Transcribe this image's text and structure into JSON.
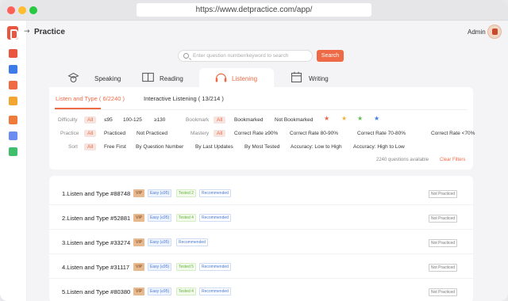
{
  "browser": {
    "url": "https://www.detpractice.com/app/"
  },
  "header": {
    "title": "Practice",
    "user": "Admin"
  },
  "search": {
    "placeholder": "Enter question number/keyword to search",
    "button": "Search"
  },
  "tabs": [
    {
      "label": "Speaking",
      "icon": "speaker-head-icon"
    },
    {
      "label": "Reading",
      "icon": "book-icon"
    },
    {
      "label": "Listening",
      "icon": "headphones-icon"
    },
    {
      "label": "Writing",
      "icon": "calendar-icon"
    }
  ],
  "subtabs": [
    {
      "label": "Listen and Type ( 6/2240 )"
    },
    {
      "label": "Interactive Listening ( 13/214 )"
    }
  ],
  "filters": {
    "difficulty": {
      "label": "Difficulty",
      "options": [
        "All",
        "≤95",
        "100-125",
        "≥130"
      ]
    },
    "bookmark": {
      "label": "Bookmark",
      "options": [
        "All",
        "Bookmarked",
        "Not Bookmarked"
      ]
    },
    "practice": {
      "label": "Practice",
      "options": [
        "All",
        "Practiced",
        "Not Practiced"
      ]
    },
    "mastery": {
      "label": "Mastery",
      "options": [
        "All",
        "Correct Rate ≥90%",
        "Correct Rate 80-90%",
        "Correct Rate 70-80%",
        "Correct Rate <70%"
      ]
    },
    "sort": {
      "label": "Sort",
      "options": [
        "All",
        "Free First",
        "By Question Number",
        "By Last Updates",
        "By Most Tested",
        "Accuracy: Low to High",
        "Accuracy: High to Low"
      ]
    },
    "star_colors": [
      "#e8664a",
      "#f0b43a",
      "#5dc04d",
      "#3e7ee6"
    ]
  },
  "summary": {
    "count": "2240 questions available",
    "clear": "Clear Filters"
  },
  "questions": [
    {
      "title": "1.Listen and Type #88748",
      "vip": "VIP",
      "level": "Easy (≤95)",
      "tested": "Tested 2",
      "rec": "Recommended",
      "status": "Not Practiced"
    },
    {
      "title": "2.Listen and Type #52881",
      "vip": "VIP",
      "level": "Easy (≤95)",
      "tested": "Tested 4",
      "rec": "Recommended",
      "status": "Not Practiced"
    },
    {
      "title": "3.Listen and Type #33274",
      "vip": "VIP",
      "level": "Easy (≤95)",
      "tested": "",
      "rec": "Recommended",
      "status": "Not Practiced"
    },
    {
      "title": "4.Listen and Type #31117",
      "vip": "VIP",
      "level": "Easy (≤95)",
      "tested": "Tested 5",
      "rec": "Recommended",
      "status": "Not Practiced"
    },
    {
      "title": "5.Listen and Type #80380",
      "vip": "VIP",
      "level": "Easy (≤95)",
      "tested": "Tested 4",
      "rec": "Recommended",
      "status": "Not Practiced"
    }
  ]
}
